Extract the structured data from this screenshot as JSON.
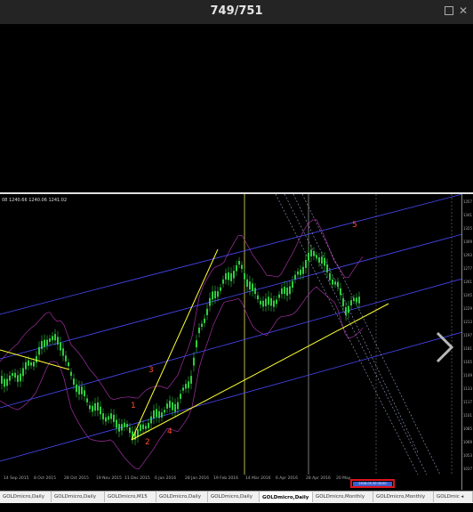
{
  "header": {
    "counter": "749/751"
  },
  "chart": {
    "ohlc_text": "08 1240.66 1240.06 1241.02",
    "price_ticks": [
      "1357",
      "1341",
      "1325",
      "1309",
      "1293",
      "1277",
      "1261",
      "1245",
      "1229",
      "1213",
      "1197",
      "1181",
      "1165",
      "1149",
      "1133",
      "1117",
      "1101",
      "1085",
      "1069",
      "1053",
      "1037"
    ],
    "dates": [
      "14 Sep 2015",
      "8 Oct 2015",
      "28 Oct 2015",
      "19 Nov 2015",
      "11 Dec 2015",
      "6 Jan 2016",
      "28 Jan 2016",
      "19 Feb 2016",
      "14 Mar 2016",
      "6 Apr 2016",
      "28 Apr 2016",
      "20 May"
    ],
    "wave_labels": [
      "1",
      "2",
      "3",
      "4",
      "5"
    ],
    "highlight_text": "2016.05.30 00:00",
    "colors": {
      "candles": "#2ecc40",
      "trendline": "#ffff33",
      "channel": "#4a4aff",
      "bands": "#a030a0",
      "wave_labels": "#ff4d2b",
      "highlight_border": "#e0141e"
    }
  },
  "nav": {
    "next_icon": "chevron-right-icon"
  },
  "tabs": [
    "GOLDmicro,Daily",
    "GOLDmicro,Daily",
    "GOLDmicro,M15",
    "GOLDmicro,Daily",
    "GOLDmicro,Daily",
    "GOLDmicro,Daily",
    "GOLDmicro,Monthly",
    "GOLDmicro,Monthly",
    "GOLDmic ◂"
  ],
  "active_tab_index": 5
}
